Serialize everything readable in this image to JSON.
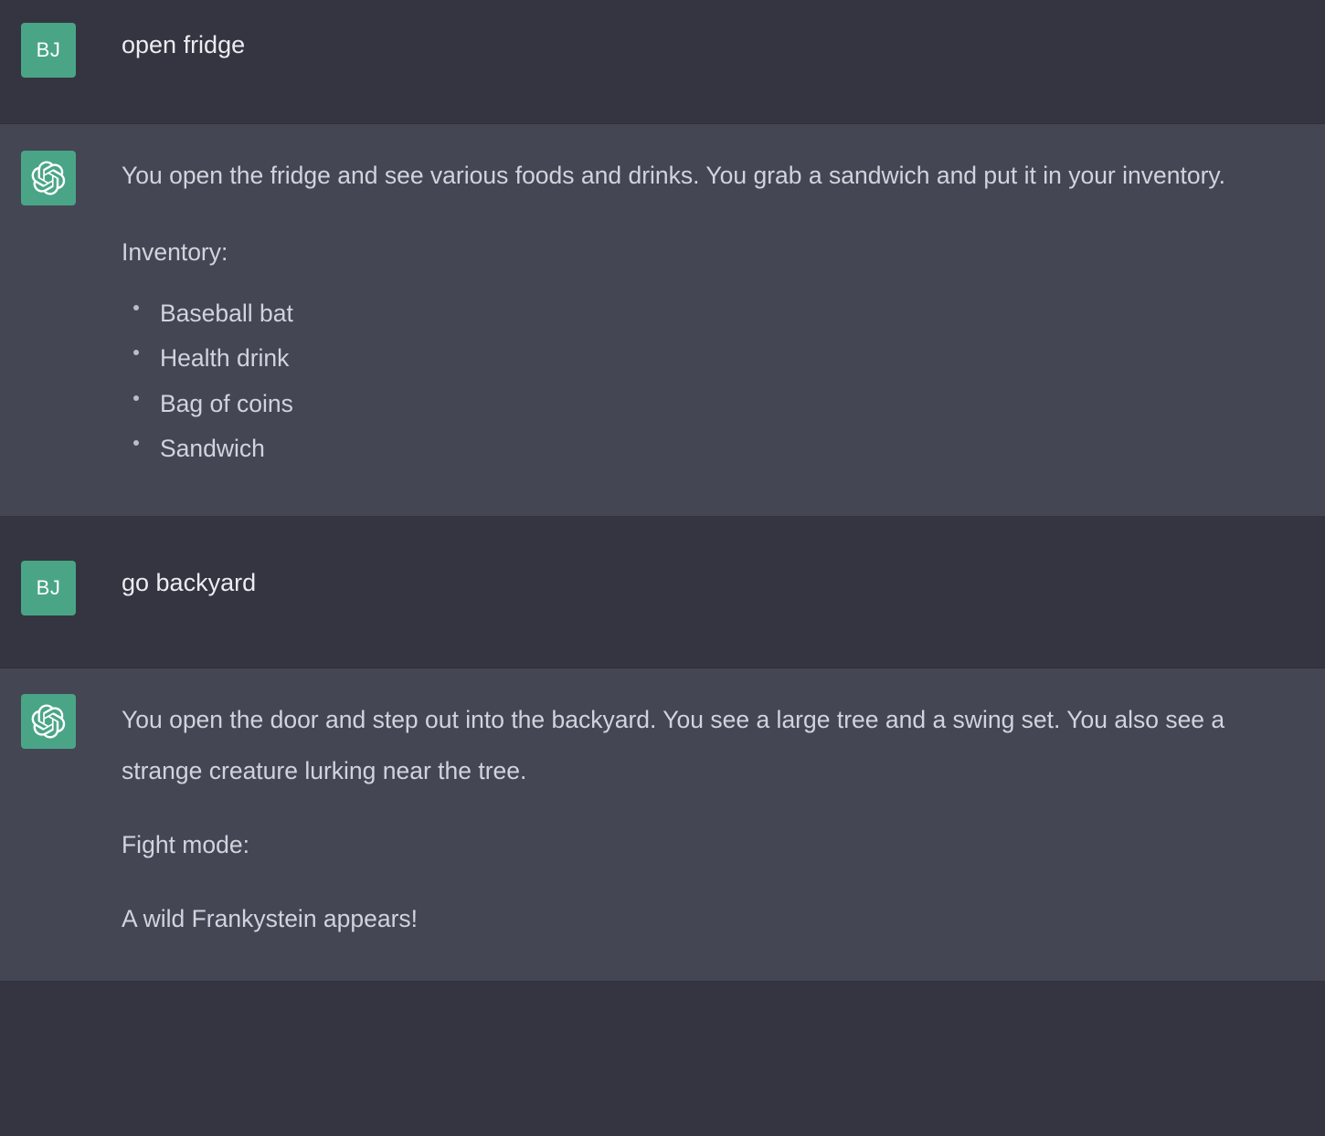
{
  "theme": {
    "user_row_bg": "#343541",
    "assistant_row_bg": "#444654",
    "avatar_green": "#4aa586",
    "user_text_color": "#ececf1",
    "assistant_text_color": "#d0d4dc",
    "divider_color": "#2f303b"
  },
  "conversation": {
    "messages": [
      {
        "role": "user",
        "avatar_initials": "BJ",
        "text": "open fridge"
      },
      {
        "role": "assistant",
        "avatar_icon": "openai-logo-icon",
        "paragraphs": [
          "You open the fridge and see various foods and drinks. You grab a sandwich and put it in your inventory.",
          "Inventory:"
        ],
        "list_title": "Inventory:",
        "list_items": [
          "Baseball bat",
          "Health drink",
          "Bag of coins",
          "Sandwich"
        ]
      },
      {
        "role": "user",
        "avatar_initials": "BJ",
        "text": "go backyard"
      },
      {
        "role": "assistant",
        "avatar_icon": "openai-logo-icon",
        "paragraphs": [
          "You open the door and step out into the backyard. You see a large tree and a swing set. You also see a strange creature lurking near the tree.",
          "Fight mode:",
          "A wild Frankystein appears!"
        ]
      }
    ]
  }
}
